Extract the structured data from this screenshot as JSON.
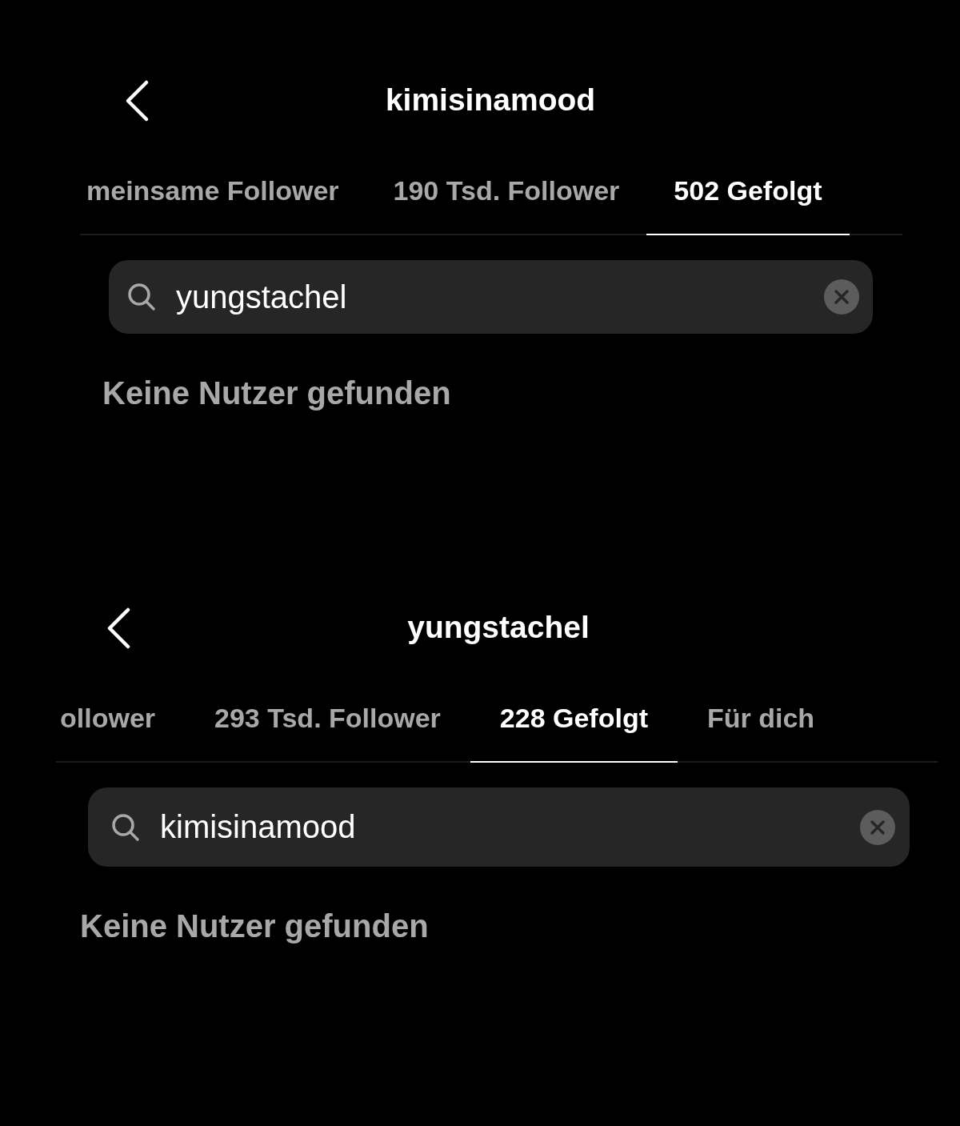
{
  "panels": [
    {
      "title": "kimisinamood",
      "tabs": [
        {
          "label": "meinsame Follower",
          "selected": false
        },
        {
          "label": "190 Tsd. Follower",
          "selected": false
        },
        {
          "label": "502 Gefolgt",
          "selected": true
        }
      ],
      "search": {
        "value": "yungstachel"
      },
      "message": "Keine Nutzer gefunden"
    },
    {
      "title": "yungstachel",
      "tabs": [
        {
          "label": "ollower",
          "selected": false
        },
        {
          "label": "293 Tsd. Follower",
          "selected": false
        },
        {
          "label": "228 Gefolgt",
          "selected": true
        },
        {
          "label": "Für dich",
          "selected": false
        }
      ],
      "search": {
        "value": "kimisinamood"
      },
      "message": "Keine Nutzer gefunden"
    }
  ]
}
